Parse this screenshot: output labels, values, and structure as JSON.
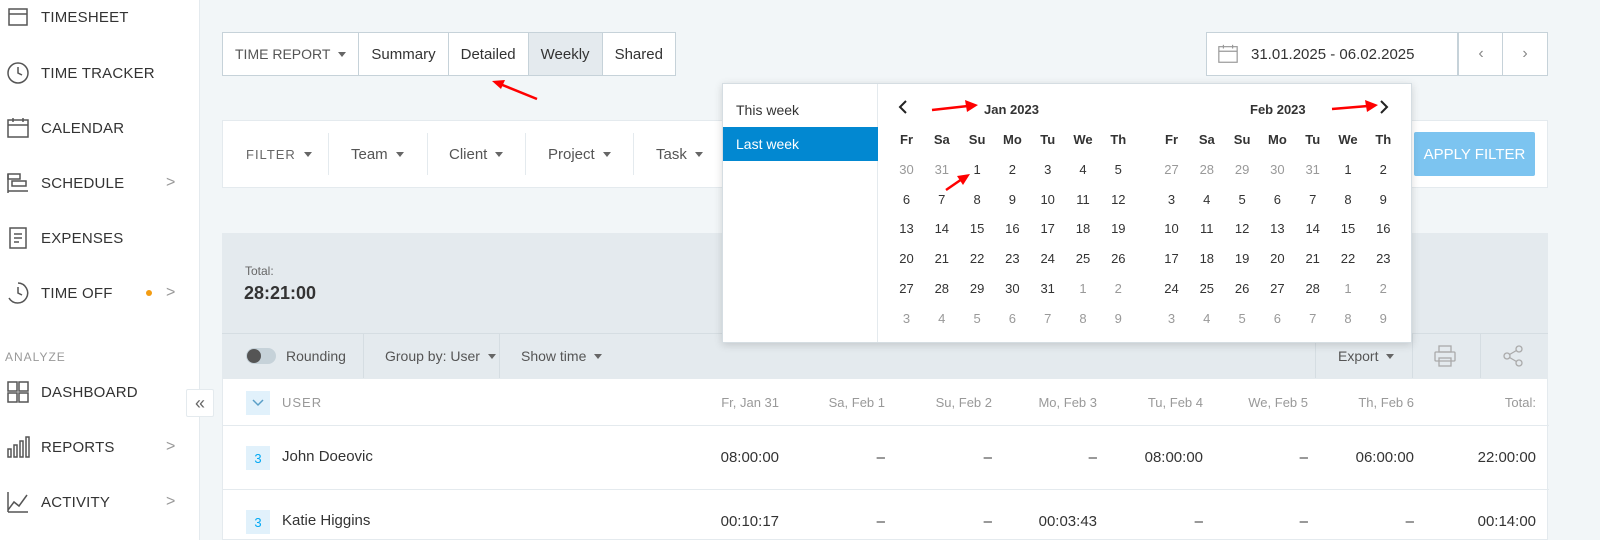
{
  "sidebar": {
    "items": [
      {
        "label": "TIMESHEET",
        "icon": "timesheet-icon"
      },
      {
        "label": "TIME TRACKER",
        "icon": "clock-icon"
      },
      {
        "label": "CALENDAR",
        "icon": "calendar-icon"
      },
      {
        "label": "SCHEDULE",
        "icon": "schedule-icon",
        "chevron": ">"
      },
      {
        "label": "EXPENSES",
        "icon": "receipt-icon"
      },
      {
        "label": "TIME OFF",
        "icon": "time-off-icon",
        "chevron": ">"
      },
      {
        "label": "DASHBOARD",
        "icon": "dashboard-icon"
      },
      {
        "label": "REPORTS",
        "icon": "reports-icon",
        "chevron": ">"
      },
      {
        "label": "ACTIVITY",
        "icon": "activity-icon",
        "chevron": ">"
      }
    ],
    "section_analyze": "ANALYZE",
    "collapse": "«"
  },
  "tabs": {
    "report_type": "TIME REPORT",
    "items": [
      "Summary",
      "Detailed",
      "Weekly",
      "Shared"
    ],
    "active": "Weekly"
  },
  "date_range": {
    "value": "31.01.2025 - 06.02.2025",
    "prev": "‹",
    "next": "›"
  },
  "filter": {
    "label": "FILTER",
    "items": [
      "Team",
      "Client",
      "Project",
      "Task"
    ],
    "apply": "APPLY FILTER"
  },
  "totals": {
    "label": "Total:",
    "value": "28:21:00"
  },
  "toolbar": {
    "rounding": "Rounding",
    "group_by": "Group by: User",
    "show_time": "Show time",
    "export": "Export"
  },
  "table": {
    "user_header": "USER",
    "day_headers": [
      "Fr, Jan 31",
      "Sa, Feb 1",
      "Su, Feb 2",
      "Mo, Feb 3",
      "Tu, Feb 4",
      "We, Feb 5",
      "Th, Feb 6"
    ],
    "total_header": "Total:",
    "rows": [
      {
        "badge": "3",
        "name": "John Doeovic",
        "cells": [
          "08:00:00",
          "–",
          "–",
          "–",
          "08:00:00",
          "–",
          "06:00:00"
        ],
        "total": "22:00:00"
      },
      {
        "badge": "3",
        "name": "Katie Higgins",
        "cells": [
          "00:10:17",
          "–",
          "–",
          "00:03:43",
          "–",
          "–",
          "–"
        ],
        "total": "00:14:00"
      }
    ]
  },
  "picker": {
    "ranges": [
      "This week",
      "Last week"
    ],
    "active_range": "Last week",
    "weekdays": [
      "Fr",
      "Sa",
      "Su",
      "Mo",
      "Tu",
      "We",
      "Th"
    ],
    "months": [
      {
        "title": "Jan 2023",
        "weeks": [
          [
            [
              "30",
              1
            ],
            [
              "31",
              1
            ],
            [
              "1",
              0
            ],
            [
              "2",
              0
            ],
            [
              "3",
              0
            ],
            [
              "4",
              0
            ],
            [
              "5",
              0
            ]
          ],
          [
            [
              "6",
              0
            ],
            [
              "7",
              0
            ],
            [
              "8",
              0
            ],
            [
              "9",
              0
            ],
            [
              "10",
              0
            ],
            [
              "11",
              0
            ],
            [
              "12",
              0
            ]
          ],
          [
            [
              "13",
              0
            ],
            [
              "14",
              0
            ],
            [
              "15",
              0
            ],
            [
              "16",
              0
            ],
            [
              "17",
              0
            ],
            [
              "18",
              0
            ],
            [
              "19",
              0
            ]
          ],
          [
            [
              "20",
              0
            ],
            [
              "21",
              0
            ],
            [
              "22",
              0
            ],
            [
              "23",
              0
            ],
            [
              "24",
              0
            ],
            [
              "25",
              0
            ],
            [
              "26",
              0
            ]
          ],
          [
            [
              "27",
              0
            ],
            [
              "28",
              0
            ],
            [
              "29",
              0
            ],
            [
              "30",
              0
            ],
            [
              "31",
              0
            ],
            [
              "1",
              1
            ],
            [
              "2",
              1
            ]
          ],
          [
            [
              "3",
              1
            ],
            [
              "4",
              1
            ],
            [
              "5",
              1
            ],
            [
              "6",
              1
            ],
            [
              "7",
              1
            ],
            [
              "8",
              1
            ],
            [
              "9",
              1
            ]
          ]
        ]
      },
      {
        "title": "Feb 2023",
        "weeks": [
          [
            [
              "27",
              1
            ],
            [
              "28",
              1
            ],
            [
              "29",
              1
            ],
            [
              "30",
              1
            ],
            [
              "31",
              1
            ],
            [
              "1",
              0
            ],
            [
              "2",
              0
            ]
          ],
          [
            [
              "3",
              0
            ],
            [
              "4",
              0
            ],
            [
              "5",
              0
            ],
            [
              "6",
              0
            ],
            [
              "7",
              0
            ],
            [
              "8",
              0
            ],
            [
              "9",
              0
            ]
          ],
          [
            [
              "10",
              0
            ],
            [
              "11",
              0
            ],
            [
              "12",
              0
            ],
            [
              "13",
              0
            ],
            [
              "14",
              0
            ],
            [
              "15",
              0
            ],
            [
              "16",
              0
            ]
          ],
          [
            [
              "17",
              0
            ],
            [
              "18",
              0
            ],
            [
              "19",
              0
            ],
            [
              "20",
              0
            ],
            [
              "21",
              0
            ],
            [
              "22",
              0
            ],
            [
              "23",
              0
            ]
          ],
          [
            [
              "24",
              0
            ],
            [
              "25",
              0
            ],
            [
              "26",
              0
            ],
            [
              "27",
              0
            ],
            [
              "28",
              0
            ],
            [
              "1",
              1
            ],
            [
              "2",
              1
            ]
          ],
          [
            [
              "3",
              1
            ],
            [
              "4",
              1
            ],
            [
              "5",
              1
            ],
            [
              "6",
              1
            ],
            [
              "7",
              1
            ],
            [
              "8",
              1
            ],
            [
              "9",
              1
            ]
          ]
        ]
      }
    ]
  },
  "colors": {
    "accent": "#0288d1",
    "apply": "#7cc4f0",
    "annotation": "#ff0000",
    "dot": "#f39c12"
  }
}
